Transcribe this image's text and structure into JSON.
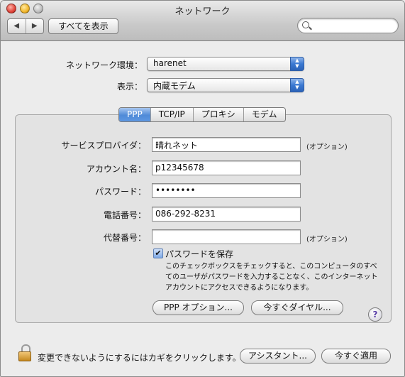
{
  "window": {
    "title": "ネットワーク"
  },
  "toolbar": {
    "back_glyph": "◀",
    "forward_glyph": "▶",
    "show_all_label": "すべてを表示",
    "search_value": "",
    "search_icon": "magnifier-icon"
  },
  "location": {
    "label": "ネットワーク環境：",
    "value": "harenet"
  },
  "show": {
    "label": "表示：",
    "value": "内蔵モデム"
  },
  "tabs": [
    {
      "label": "PPP",
      "active": true
    },
    {
      "label": "TCP/IP",
      "active": false
    },
    {
      "label": "プロキシ",
      "active": false
    },
    {
      "label": "モデム",
      "active": false
    }
  ],
  "form": {
    "service_provider": {
      "label": "サービスプロバイダ：",
      "value": "晴れネット",
      "note": "(オプション)"
    },
    "account_name": {
      "label": "アカウント名：",
      "value": "p12345678"
    },
    "password": {
      "label": "パスワード：",
      "value": "••••••••"
    },
    "phone": {
      "label": "電話番号：",
      "value": "086-292-8231"
    },
    "alt_phone": {
      "label": "代替番号：",
      "value": "",
      "note": "(オプション)"
    }
  },
  "save_password": {
    "checked": true,
    "check_glyph": "✔",
    "label": "パスワードを保存",
    "description": "このチェックボックスをチェックすると、このコンピュータのすべてのユーザがパスワードを入力することなく、このインターネットアカウントにアクセスできるようになります。"
  },
  "buttons": {
    "ppp_options": "PPP オプション...",
    "dial_now": "今すぐダイヤル...",
    "help": "?",
    "assistant": "アシスタント...",
    "apply_now": "今すぐ適用"
  },
  "footer": {
    "lock_text": "変更できないようにするにはカギをクリックします。"
  },
  "colors": {
    "accent": "#3b79d2",
    "window_bg": "#ececec"
  }
}
